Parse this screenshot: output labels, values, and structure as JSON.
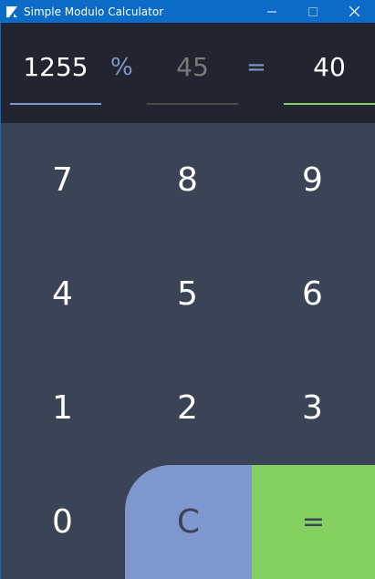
{
  "window": {
    "title": "Simple Modulo Calculator",
    "icon": "app-logo-icon",
    "controls": [
      "minimize-icon",
      "maximize-icon",
      "close-icon"
    ]
  },
  "display": {
    "dividend": "1255",
    "operator": "%",
    "divisor_placeholder": "45",
    "equals_sign": "=",
    "result": "40"
  },
  "keypad": {
    "keys": [
      "7",
      "8",
      "9",
      "4",
      "5",
      "6",
      "1",
      "2",
      "3",
      "0",
      "C",
      "="
    ]
  },
  "colors": {
    "titlebar": "#0c6bc6",
    "display_bg": "#222530",
    "keypad_bg": "#3b4456",
    "accent_blue": "#7f97cf",
    "accent_green": "#84d060",
    "placeholder": "#7a7a7a"
  }
}
